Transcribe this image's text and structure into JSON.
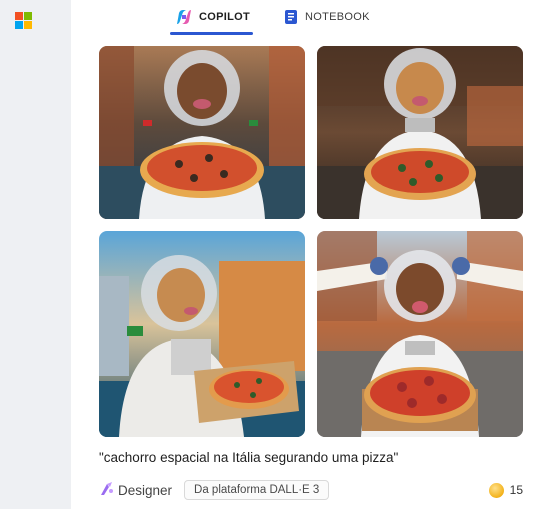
{
  "tabs": [
    {
      "label": "COPILOT",
      "icon": "copilot-icon",
      "active": true
    },
    {
      "label": "NOTEBOOK",
      "icon": "notebook-icon",
      "active": false
    }
  ],
  "brand": {
    "logo": "microsoft-logo"
  },
  "images": [
    {
      "alt_icon": "generated-image-1"
    },
    {
      "alt_icon": "generated-image-2"
    },
    {
      "alt_icon": "generated-image-3"
    },
    {
      "alt_icon": "generated-image-4"
    }
  ],
  "prompt_caption": "\"cachorro espacial na Itália segurando uma pizza\"",
  "footer": {
    "designer_label": "Designer",
    "platform_badge": "Da plataforma DALL·E 3",
    "boost_count": "15"
  },
  "colors": {
    "accent": "#2b57d1",
    "coin": "#f3b21a"
  }
}
